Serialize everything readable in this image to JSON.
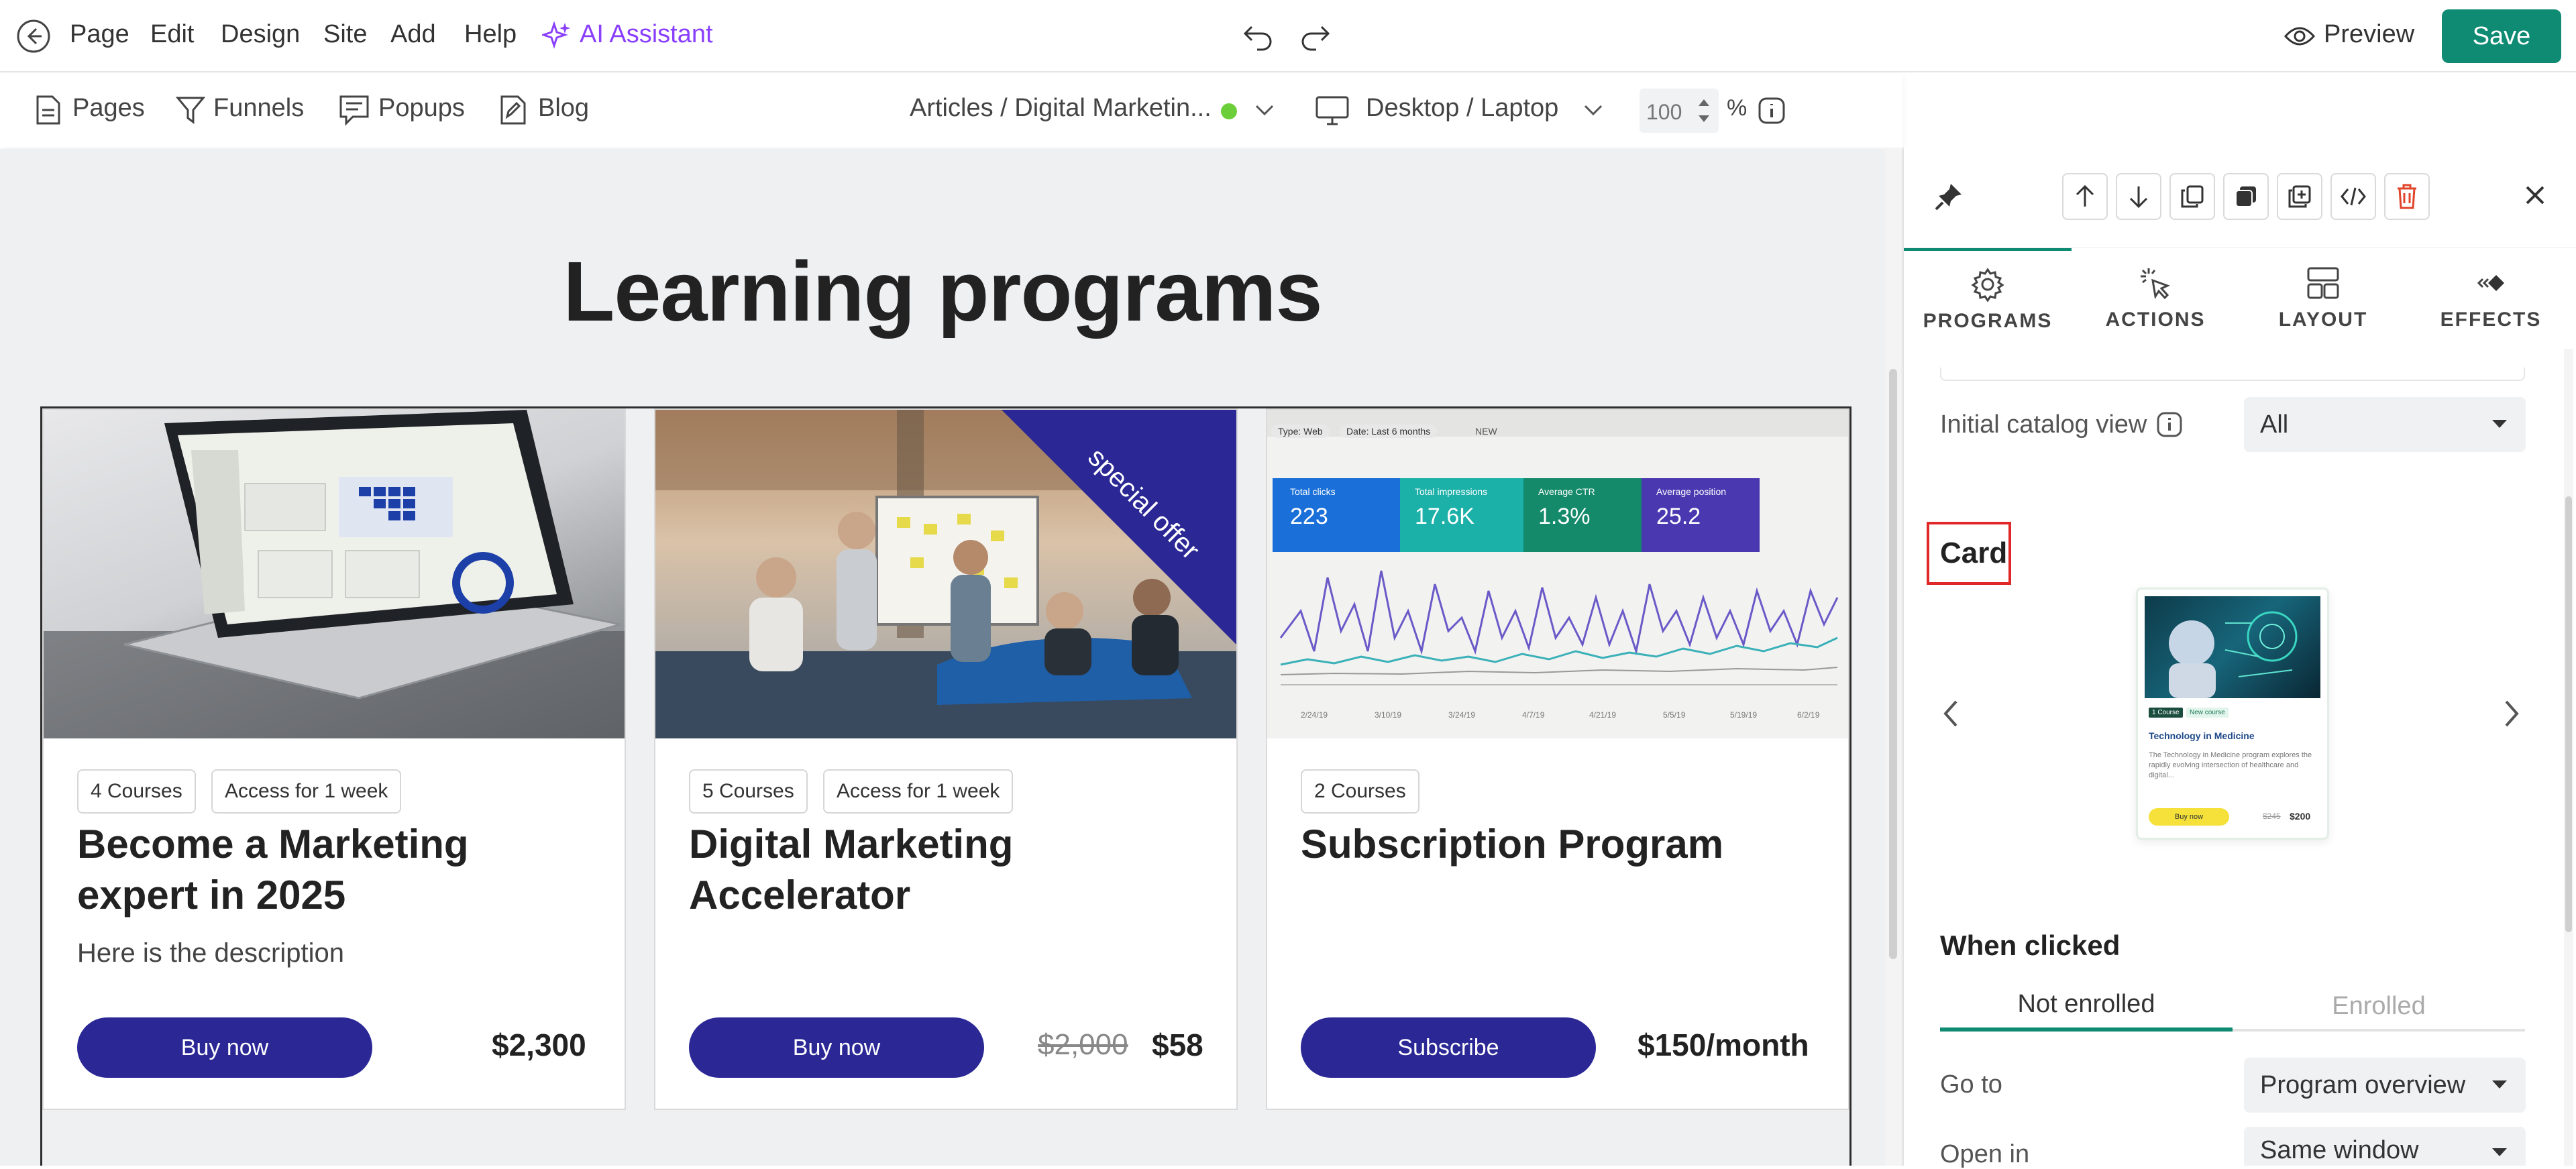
{
  "topbar": {
    "menu": [
      "Page",
      "Edit",
      "Design",
      "Site",
      "Add",
      "Help"
    ],
    "ai_assistant": "AI Assistant",
    "preview": "Preview",
    "save": "Save"
  },
  "secbar": {
    "pages": "Pages",
    "funnels": "Funnels",
    "popups": "Popups",
    "blog": "Blog",
    "page_selector": "Articles / Digital Marketin...",
    "status_color": "#6ccf3a",
    "device": "Desktop / Laptop",
    "zoom": "100",
    "zoom_unit": "%"
  },
  "canvas": {
    "title": "Learning programs",
    "cards": [
      {
        "tags": [
          "4 Courses",
          "Access for 1 week"
        ],
        "title": "Become a Marketing expert in 2025",
        "description": "Here is the description",
        "button": "Buy now",
        "price": "$2,300",
        "image": "laptop-dashboard-photo"
      },
      {
        "tags": [
          "5 Courses",
          "Access for 1 week"
        ],
        "title": "Digital Marketing Accelerator",
        "description": "",
        "button": "Buy now",
        "old_price": "$2,000",
        "price": "$58",
        "ribbon": "special offer",
        "image": "team-meeting-photo"
      },
      {
        "tags": [
          "2 Courses"
        ],
        "title": "Subscription Program",
        "description": "",
        "button": "Subscribe",
        "price": "$150/month",
        "image": "analytics-chart-photo",
        "analytics": {
          "filter1": "Type: Web",
          "filter2": "Date: Last 6 months",
          "new": "NEW",
          "metrics": [
            {
              "label": "Total clicks",
              "value": "223",
              "color": "#1a6fd8"
            },
            {
              "label": "Total impressions",
              "value": "17.6K",
              "color": "#1bb0a8"
            },
            {
              "label": "Average CTR",
              "value": "1.3%",
              "color": "#148a6a"
            },
            {
              "label": "Average position",
              "value": "25.2",
              "color": "#4a38b0"
            }
          ],
          "dates": [
            "2/24/19",
            "3/10/19",
            "3/24/19",
            "4/7/19",
            "4/21/19",
            "5/5/19",
            "5/19/19",
            "6/2/19"
          ]
        }
      }
    ]
  },
  "panel": {
    "tabs": [
      "PROGRAMS",
      "ACTIONS",
      "LAYOUT",
      "EFFECTS"
    ],
    "initial_catalog_view_label": "Initial catalog view",
    "initial_catalog_view_value": "All",
    "card_heading": "Card",
    "card_preview": {
      "badge1": "1 Course",
      "badge2": "New course",
      "title": "Technology in Medicine",
      "desc": "The Technology in Medicine program explores the rapidly evolving intersection of healthcare and digital...",
      "button": "Buy now",
      "old_price": "$245",
      "price": "$200"
    },
    "when_clicked": "When clicked",
    "subtabs": [
      "Not enrolled",
      "Enrolled"
    ],
    "go_to_label": "Go to",
    "go_to_value": "Program overview",
    "open_in_label": "Open in",
    "open_in_value": "Same window",
    "accent": "#0f8b73",
    "delete_color": "#e0452b"
  }
}
